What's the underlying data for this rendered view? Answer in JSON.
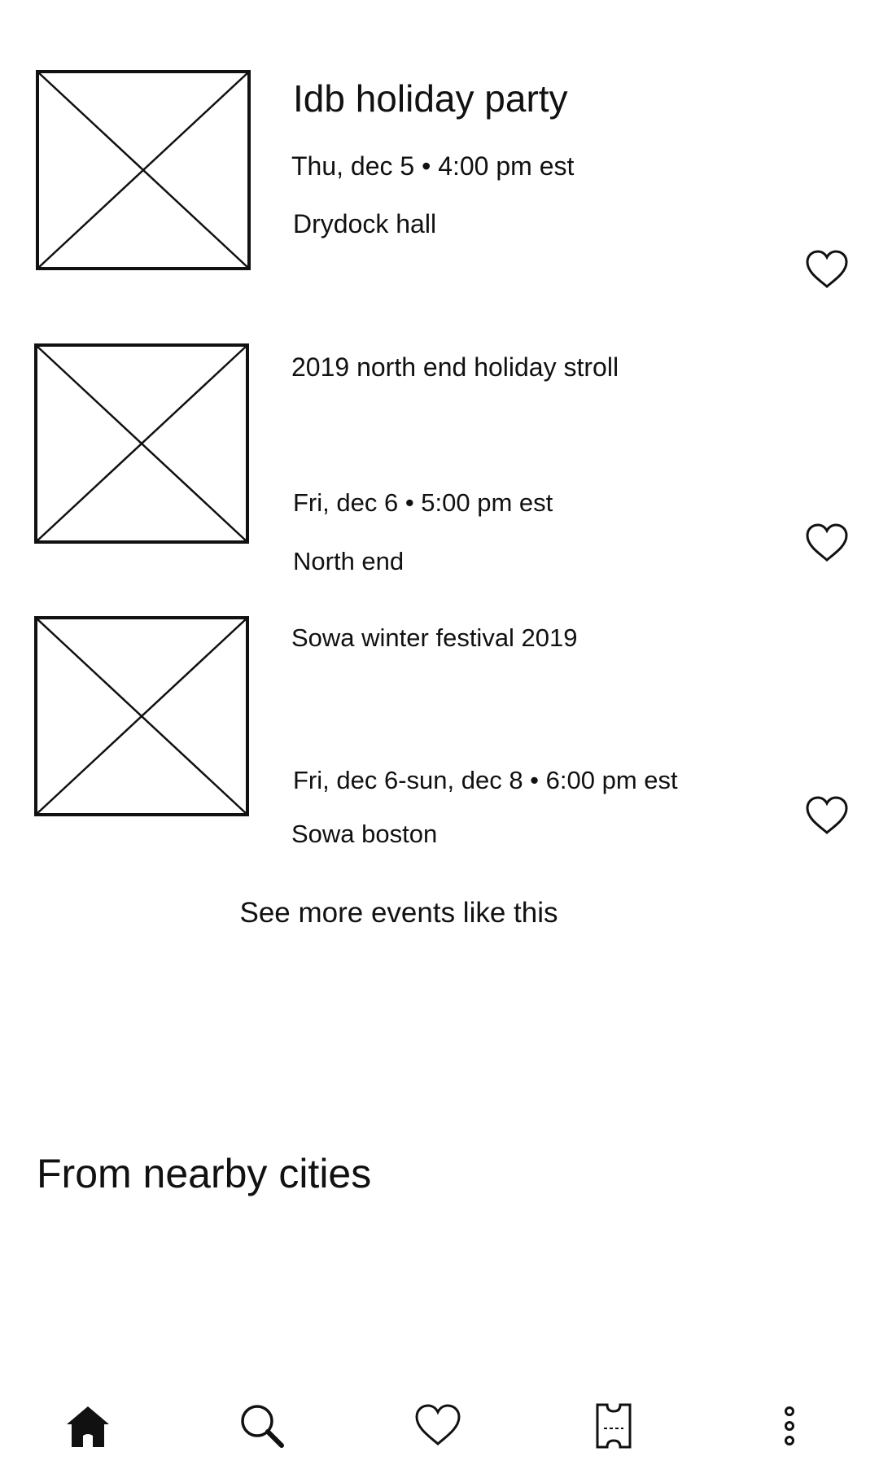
{
  "events": [
    {
      "title": "Idb holiday party",
      "datetime": "Thu, dec 5 • 4:00 pm est",
      "location": "Drydock hall"
    },
    {
      "title": "2019 north end holiday stroll",
      "datetime": "Fri, dec 6 • 5:00 pm est",
      "location": "North end"
    },
    {
      "title": "Sowa winter festival 2019",
      "datetime": "Fri, dec 6-sun, dec 8 • 6:00 pm est",
      "location": "Sowa boston"
    }
  ],
  "see_more_label": "See more events like this",
  "nearby_section_title": "From nearby cities",
  "bottom_nav": [
    "home-icon",
    "search-icon",
    "heart-icon",
    "ticket-icon",
    "more-icon"
  ],
  "colors": {
    "background": "#ffffff",
    "ink": "#111111"
  }
}
